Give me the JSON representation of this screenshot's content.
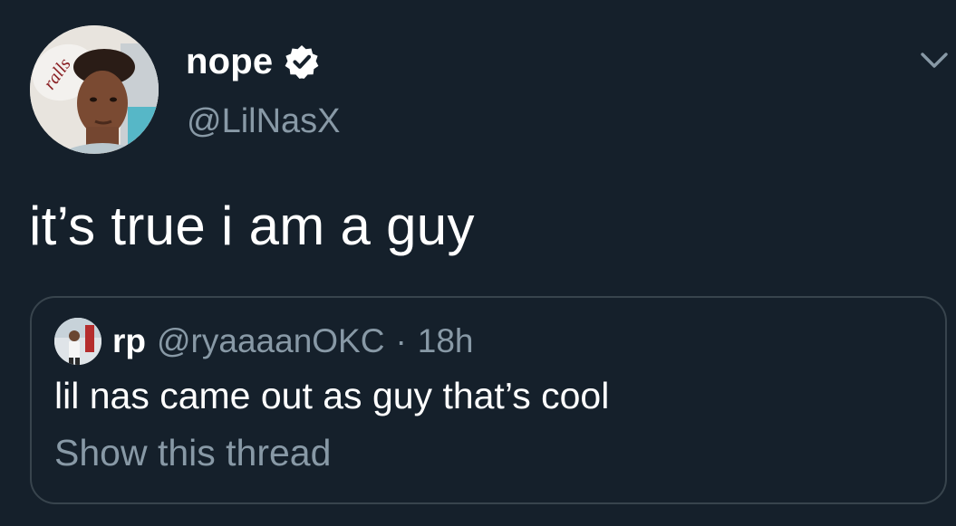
{
  "author": {
    "display_name": "nope",
    "handle": "@LilNasX",
    "verified": true,
    "avatar_icon": "profile-photo"
  },
  "tweet": {
    "text": "it’s true i am a guy"
  },
  "quoted_tweet": {
    "display_name": "rp",
    "handle": "@ryaaaanOKC",
    "separator": "·",
    "time": "18h",
    "text": "lil nas came out as guy that’s cool",
    "show_thread_label": "Show this thread",
    "avatar_icon": "profile-photo"
  },
  "menu": {
    "icon": "chevron-down-icon"
  },
  "colors": {
    "background": "#15202b",
    "text_primary": "#ffffff",
    "text_secondary": "#8899a6",
    "border": "#38444d",
    "verified_badge": "#ffffff"
  }
}
